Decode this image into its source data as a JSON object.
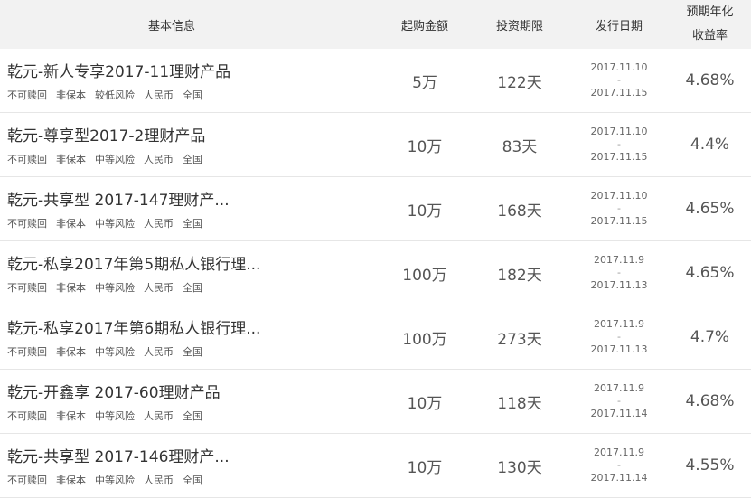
{
  "header": {
    "info": "基本信息",
    "amount": "起购金额",
    "term": "投资期限",
    "date": "发行日期",
    "rate_line1": "预期年化",
    "rate_line2": "收益率"
  },
  "rows": [
    {
      "name": "乾元-新人专享2017-11理财产品",
      "tags": [
        "不可赎回",
        "非保本",
        "较低风险",
        "人民币",
        "全国"
      ],
      "amount": "5万",
      "term": "122天",
      "date_start": "2017.11.10",
      "date_sep": "-",
      "date_end": "2017.11.15",
      "rate": "4.68%"
    },
    {
      "name": "乾元-尊享型2017-2理财产品",
      "tags": [
        "不可赎回",
        "非保本",
        "中等风险",
        "人民币",
        "全国"
      ],
      "amount": "10万",
      "term": "83天",
      "date_start": "2017.11.10",
      "date_sep": "-",
      "date_end": "2017.11.15",
      "rate": "4.4%"
    },
    {
      "name": "乾元-共享型 2017-147理财产...",
      "tags": [
        "不可赎回",
        "非保本",
        "中等风险",
        "人民币",
        "全国"
      ],
      "amount": "10万",
      "term": "168天",
      "date_start": "2017.11.10",
      "date_sep": "-",
      "date_end": "2017.11.15",
      "rate": "4.65%"
    },
    {
      "name": "乾元-私享2017年第5期私人银行理...",
      "tags": [
        "不可赎回",
        "非保本",
        "中等风险",
        "人民币",
        "全国"
      ],
      "amount": "100万",
      "term": "182天",
      "date_start": "2017.11.9",
      "date_sep": "-",
      "date_end": "2017.11.13",
      "rate": "4.65%"
    },
    {
      "name": "乾元-私享2017年第6期私人银行理...",
      "tags": [
        "不可赎回",
        "非保本",
        "中等风险",
        "人民币",
        "全国"
      ],
      "amount": "100万",
      "term": "273天",
      "date_start": "2017.11.9",
      "date_sep": "-",
      "date_end": "2017.11.13",
      "rate": "4.7%"
    },
    {
      "name": "乾元-开鑫享 2017-60理财产品",
      "tags": [
        "不可赎回",
        "非保本",
        "中等风险",
        "人民币",
        "全国"
      ],
      "amount": "10万",
      "term": "118天",
      "date_start": "2017.11.9",
      "date_sep": "-",
      "date_end": "2017.11.14",
      "rate": "4.68%"
    },
    {
      "name": "乾元-共享型 2017-146理财产...",
      "tags": [
        "不可赎回",
        "非保本",
        "中等风险",
        "人民币",
        "全国"
      ],
      "amount": "10万",
      "term": "130天",
      "date_start": "2017.11.9",
      "date_sep": "-",
      "date_end": "2017.11.14",
      "rate": "4.55%"
    }
  ]
}
